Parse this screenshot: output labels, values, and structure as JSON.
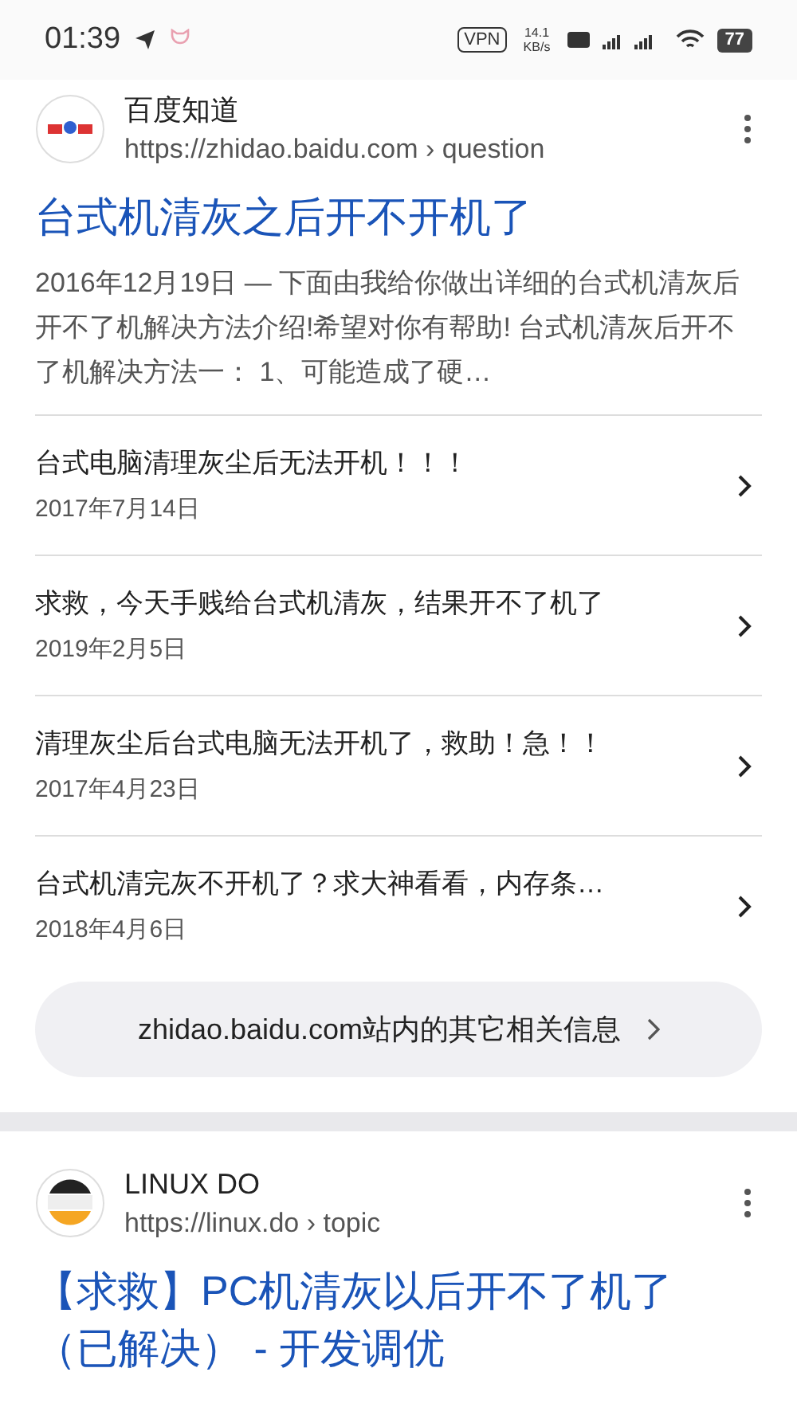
{
  "status_bar": {
    "time": "01:39",
    "vpn": "VPN",
    "speed": "14.1 KB/s",
    "battery": "77"
  },
  "results": [
    {
      "site": "百度知道",
      "url": "https://zhidao.baidu.com › question",
      "kind": "baidu",
      "title": "台式机清灰之后开不开机了",
      "snippet": "2016年12月19日 — 下面由我给你做出详细的台式机清灰后开不了机解决方法介绍!希望对你有帮助! 台式机清灰后开不了机解决方法一： 1、可能造成了硬…",
      "related": [
        {
          "title": "台式电脑清理灰尘后无法开机！！！",
          "date": "2017年7月14日"
        },
        {
          "title": "求救，今天手贱给台式机清灰，结果开不了机了",
          "date": "2019年2月5日"
        },
        {
          "title": "清理灰尘后台式电脑无法开机了，救助！急！！",
          "date": "2017年4月23日"
        },
        {
          "title": "台式机清完灰不开机了？求大神看看，内存条…",
          "date": "2018年4月6日"
        }
      ],
      "more": "zhidao.baidu.com站内的其它相关信息"
    },
    {
      "site": "LINUX DO",
      "url": "https://linux.do › topic",
      "kind": "linuxdo",
      "title": "【求救】PC机清灰以后开不了机了（已解决） - 开发调优"
    }
  ]
}
